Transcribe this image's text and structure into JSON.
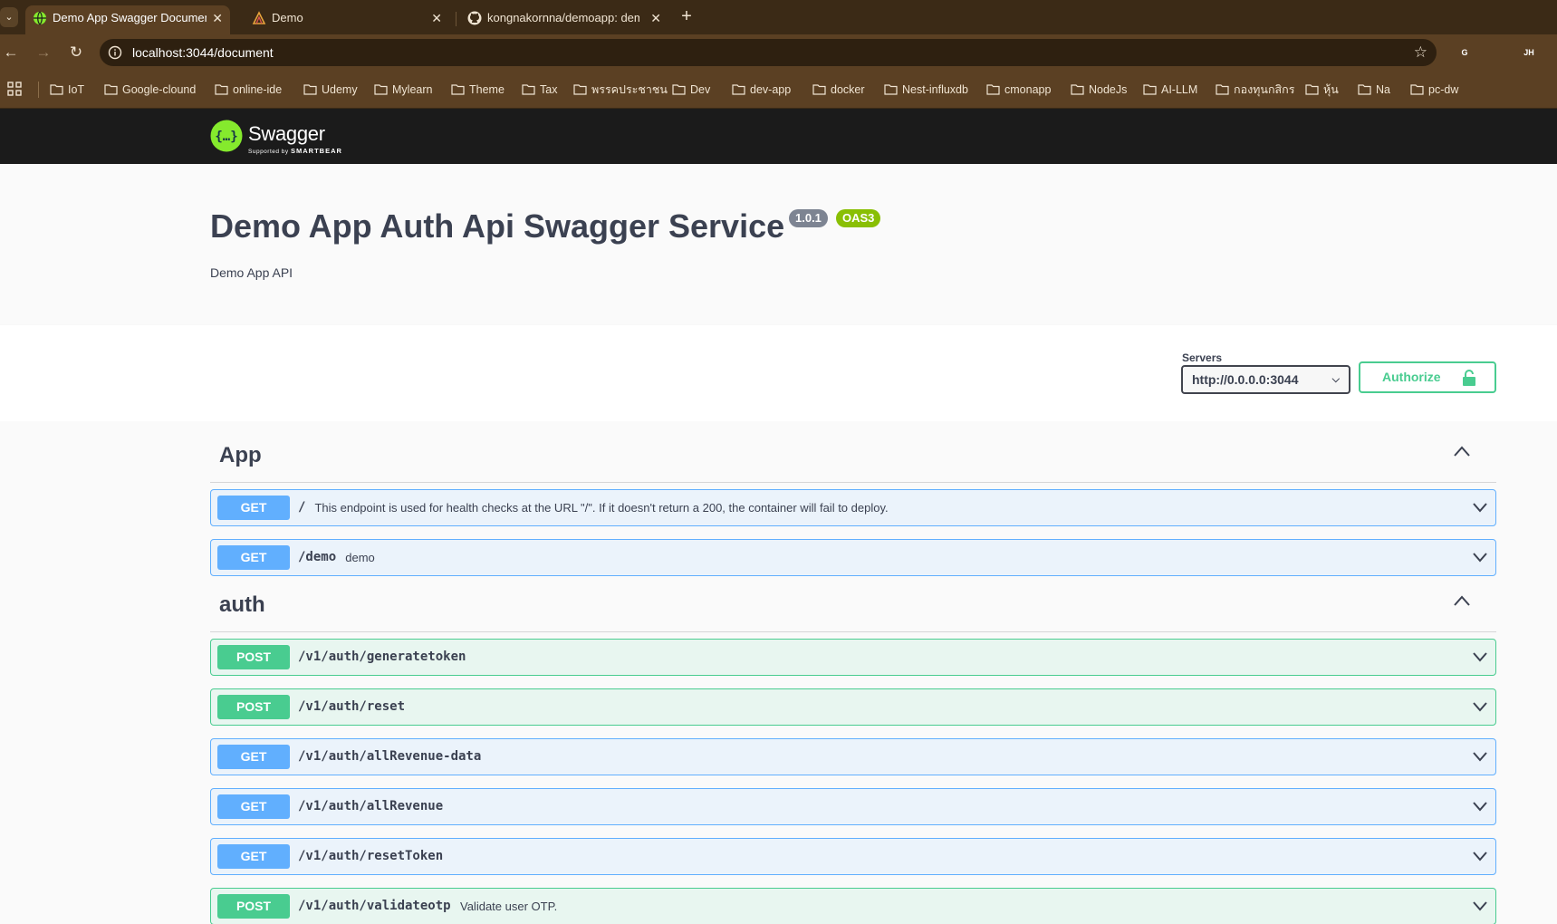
{
  "browser": {
    "tabs": [
      {
        "title": "Demo App Swagger Document",
        "icon": "globe-icon"
      },
      {
        "title": "Demo",
        "icon": "demo-logo-icon"
      },
      {
        "title": "kongnakornna/demoapp: demo",
        "icon": "github-icon"
      }
    ],
    "url": "localhost:3044/document",
    "bookmarks": [
      "IoT",
      "Google-clound",
      "online-ide",
      "Udemy",
      "Mylearn",
      "Theme",
      "Tax",
      "พรรคประชาชน",
      "Dev",
      "dev-app",
      "docker",
      "Nest-influxdb",
      "cmonapp",
      "NodeJs",
      "AI-LLM",
      "กองทุนกสิกร",
      "หุ้น",
      "Na",
      "pc-dw"
    ],
    "extensions": [
      {
        "label": "G",
        "color": "#4a7fd4"
      },
      {
        "label": "",
        "color": "#e8710a"
      },
      {
        "label": "JH",
        "color": "#4a7fd4"
      }
    ]
  },
  "swagger": {
    "logo_text": "Swagger",
    "logo_sub_prefix": "Supported by",
    "logo_sub_brand": "SMARTBEAR",
    "title": "Demo App Auth Api Swagger Service",
    "version": "1.0.1",
    "oas": "OAS3",
    "description": "Demo App API",
    "servers_label": "Servers",
    "server_value": "http://0.0.0.0:3044",
    "authorize_label": "Authorize",
    "colors": {
      "get": "#61affe",
      "post": "#49cc90",
      "topbar": "#1b1b1b"
    },
    "tags": [
      {
        "name": "App",
        "operations": [
          {
            "method": "GET",
            "path": "/",
            "summary": "This endpoint is used for health checks at the URL \"/\". If it doesn't return a 200, the container will fail to deploy."
          },
          {
            "method": "GET",
            "path": "/demo",
            "summary": "demo"
          }
        ]
      },
      {
        "name": "auth",
        "operations": [
          {
            "method": "POST",
            "path": "/v1/auth/generatetoken",
            "summary": ""
          },
          {
            "method": "POST",
            "path": "/v1/auth/reset",
            "summary": ""
          },
          {
            "method": "GET",
            "path": "/v1/auth/allRevenue-data",
            "summary": ""
          },
          {
            "method": "GET",
            "path": "/v1/auth/allRevenue",
            "summary": ""
          },
          {
            "method": "GET",
            "path": "/v1/auth/resetToken",
            "summary": ""
          },
          {
            "method": "POST",
            "path": "/v1/auth/validateotp",
            "summary": "Validate user OTP."
          }
        ]
      }
    ]
  }
}
